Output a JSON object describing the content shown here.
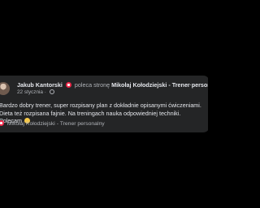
{
  "review": {
    "author": "Jakub Kantorski",
    "verb": "poleca stronę",
    "page_name": "Mikołaj Kołodziejski - Trener personalny",
    "date": "22 stycznia",
    "meta_separator": "·",
    "more_label": "···",
    "text": "Bardzo dobry trener, super rozpisany plan z dokładnie opisanymi ćwiczeniami. Dieta też rozpisana fajnie. Na treningach nauka odpowiedniej techniki. Polecam",
    "page_tag": "Mikołaj Kołodziejski - Trener personalny"
  },
  "colors": {
    "background": "#000000",
    "card": "#242526",
    "text_primary": "#e4e6eb",
    "text_secondary": "#b0b3b8",
    "recommend_icon": "#f02849",
    "emoji": "#f7c948"
  },
  "icons": {
    "avatar": "profile-photo",
    "recommend": "recommend-icon",
    "privacy": "globe-icon",
    "more": "more-icon",
    "emoji": "smiling-face-icon"
  }
}
